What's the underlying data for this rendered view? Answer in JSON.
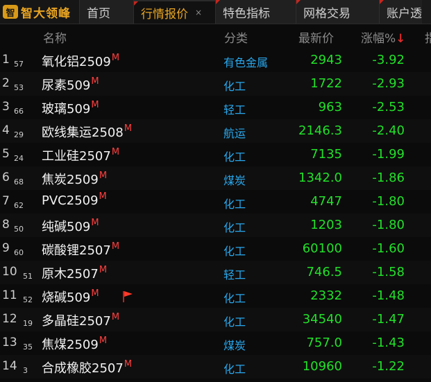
{
  "app": {
    "logo_mark": "智",
    "name": "智大领峰"
  },
  "tabs": [
    {
      "label": "首页",
      "active": false
    },
    {
      "label": "行情报价",
      "active": true,
      "close": "×"
    },
    {
      "label": "特色指标",
      "active": false
    },
    {
      "label": "网格交易",
      "active": false
    },
    {
      "label": "账户透视",
      "active": false
    },
    {
      "label": "指",
      "active": false
    }
  ],
  "table": {
    "columns": [
      "名称",
      "分类",
      "最新价",
      "涨幅%"
    ],
    "sort_indicator": "↓",
    "rows": [
      {
        "idx": "1",
        "sub": "57",
        "name": "氧化铝2509",
        "badge": "M",
        "category": "有色金属",
        "price": "2943",
        "change": "-3.92"
      },
      {
        "idx": "2",
        "sub": "53",
        "name": "尿素509",
        "badge": "M",
        "category": "化工",
        "price": "1722",
        "change": "-2.93"
      },
      {
        "idx": "3",
        "sub": "66",
        "name": "玻璃509",
        "badge": "M",
        "category": "轻工",
        "price": "963",
        "change": "-2.53"
      },
      {
        "idx": "4",
        "sub": "29",
        "name": "欧线集运2508",
        "badge": "M",
        "category": "航运",
        "price": "2146.3",
        "change": "-2.40"
      },
      {
        "idx": "5",
        "sub": "24",
        "name": "工业硅2507",
        "badge": "M",
        "category": "化工",
        "price": "7135",
        "change": "-1.99"
      },
      {
        "idx": "6",
        "sub": "68",
        "name": "焦炭2509",
        "badge": "M",
        "category": "煤炭",
        "price": "1342.0",
        "change": "-1.86"
      },
      {
        "idx": "7",
        "sub": "62",
        "name": "PVC2509",
        "badge": "M",
        "category": "化工",
        "price": "4747",
        "change": "-1.80"
      },
      {
        "idx": "8",
        "sub": "50",
        "name": "纯碱509",
        "badge": "M",
        "category": "化工",
        "price": "1203",
        "change": "-1.80"
      },
      {
        "idx": "9",
        "sub": "60",
        "name": "碳酸锂2507",
        "badge": "M",
        "category": "化工",
        "price": "60100",
        "change": "-1.60"
      },
      {
        "idx": "10",
        "sub": "51",
        "name": "原木2507",
        "badge": "M",
        "category": "轻工",
        "price": "746.5",
        "change": "-1.58"
      },
      {
        "idx": "11",
        "sub": "52",
        "name": "烧碱509",
        "badge": "M",
        "category": "化工",
        "price": "2332",
        "change": "-1.48",
        "flag": true
      },
      {
        "idx": "12",
        "sub": "19",
        "name": "多晶硅2507",
        "badge": "M",
        "category": "化工",
        "price": "34540",
        "change": "-1.47"
      },
      {
        "idx": "13",
        "sub": "35",
        "name": "焦煤2509",
        "badge": "M",
        "category": "煤炭",
        "price": "757.0",
        "change": "-1.43"
      },
      {
        "idx": "14",
        "sub": "3",
        "name": "合成橡胶2507",
        "badge": "M",
        "category": "化工",
        "price": "10960",
        "change": "-1.22"
      }
    ]
  },
  "colors": {
    "down": "#22e12a",
    "category": "#28a8ee",
    "accent": "#e8a422",
    "badge": "#ff4040"
  }
}
